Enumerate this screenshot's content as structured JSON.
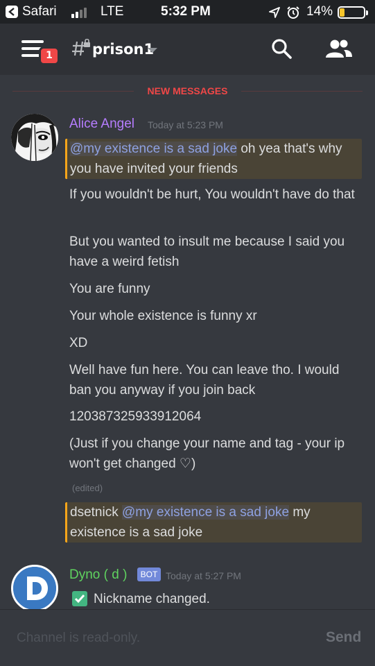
{
  "status_bar": {
    "back_app": "Safari",
    "network": "LTE",
    "time": "5:32 PM",
    "battery": "14%",
    "battery_level": 0.14
  },
  "header": {
    "notification_count": "1",
    "channel_name": "prison1"
  },
  "divider": {
    "label": "NEW MESSAGES"
  },
  "messages": [
    {
      "author": "Alice Angel",
      "author_color": "#b67dff",
      "timestamp": "Today at 5:23 PM",
      "lines": [
        {
          "type": "mention",
          "mention": "@my existence is a sad joke",
          "text": " oh yea that's why you have invited your friends"
        },
        {
          "type": "text",
          "text": "If you wouldn't be hurt, You wouldn't have do that"
        },
        {
          "type": "text",
          "text": "But you wanted to insult me because I said you have a weird fetish"
        },
        {
          "type": "text",
          "text": "You are funny"
        },
        {
          "type": "text",
          "text": "Your whole existence is funny xr"
        },
        {
          "type": "text",
          "text": "XD"
        },
        {
          "type": "text",
          "text": "Well have fun here. You can leave tho. I would ban you anyway if you join back"
        },
        {
          "type": "text",
          "text": "120387325933912064"
        },
        {
          "type": "text",
          "text": "(Just if you change your name and tag - your ip won't get changed ♡)"
        }
      ],
      "edited": "(edited)",
      "last": {
        "prefix": "dsetnick ",
        "mention": "@my existence is a sad joke",
        "text": " my existence is a sad joke"
      }
    },
    {
      "author": "Dyno ( d )",
      "author_color": "#5fd35f",
      "bot_tag": "BOT",
      "timestamp": "Today at 5:27 PM",
      "text": "Nickname changed."
    }
  ],
  "input": {
    "placeholder": "Channel is read-only.",
    "send_label": "Send"
  }
}
